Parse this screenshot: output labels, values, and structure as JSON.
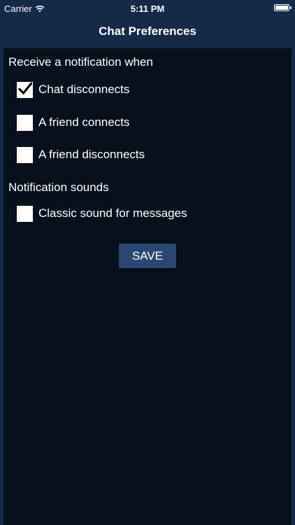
{
  "status_bar": {
    "carrier": "Carrier",
    "time": "5:11 PM",
    "wifi_icon": "wifi-icon",
    "battery_icon": "battery-icon"
  },
  "nav": {
    "title": "Chat Preferences"
  },
  "colors": {
    "nav_background": "#142a49",
    "panel_background": "#06101e",
    "button_background": "#2b4770",
    "text": "#ffffff"
  },
  "notifications": {
    "header": "Receive a notification when",
    "options": [
      {
        "label": "Chat disconnects",
        "checked": true
      },
      {
        "label": "A friend connects",
        "checked": false
      },
      {
        "label": "A friend disconnects",
        "checked": false
      }
    ]
  },
  "sounds": {
    "header": "Notification sounds",
    "options": [
      {
        "label": "Classic sound for messages",
        "checked": false
      }
    ]
  },
  "save_label": "SAVE"
}
